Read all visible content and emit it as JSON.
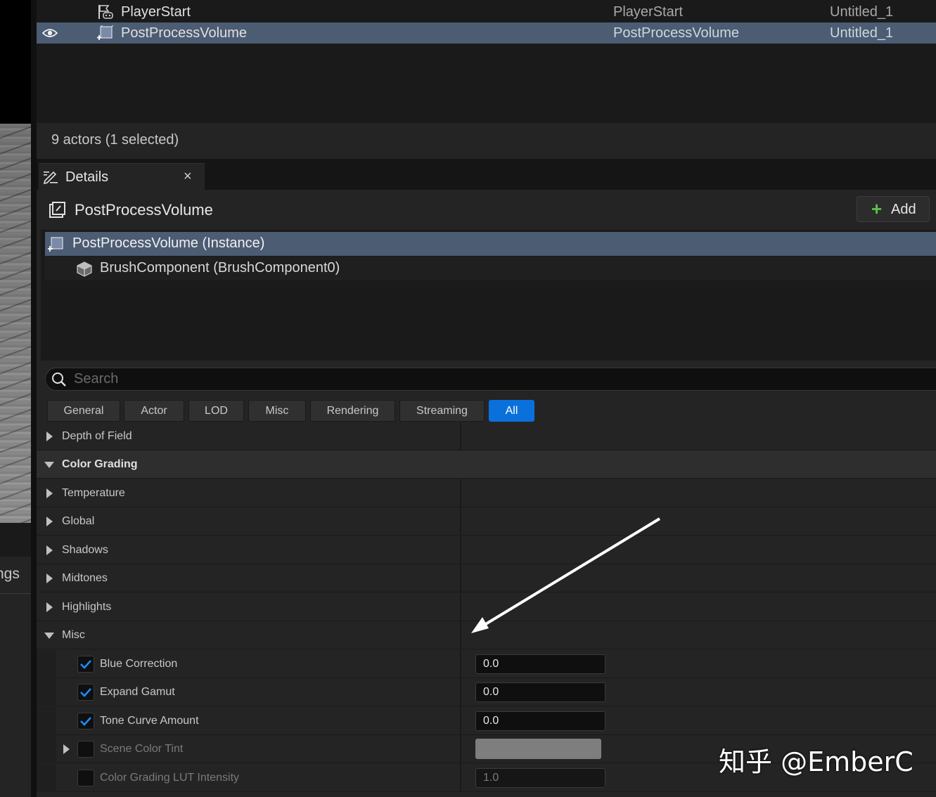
{
  "viewport": {
    "partial_label": "ngs"
  },
  "outliner": {
    "rows": [
      {
        "name": "PlayerStart",
        "type": "PlayerStart",
        "level": "Untitled_1",
        "selected": false
      },
      {
        "name": "PostProcessVolume",
        "type": "PostProcessVolume",
        "level": "Untitled_1",
        "selected": true
      }
    ],
    "status": "9 actors (1 selected)"
  },
  "details": {
    "tab_label": "Details",
    "tab_close": "×",
    "actor_name": "PostProcessVolume",
    "add_label": "Add",
    "components": {
      "root": "PostProcessVolume (Instance)",
      "child": "BrushComponent (BrushComponent0)"
    },
    "search_placeholder": "Search",
    "filters": [
      "General",
      "Actor",
      "LOD",
      "Misc",
      "Rendering",
      "Streaming",
      "All"
    ],
    "active_filter": "All",
    "categories": {
      "depth_of_field": "Depth of Field",
      "color_grading": "Color Grading",
      "temperature": "Temperature",
      "global": "Global",
      "shadows": "Shadows",
      "midtones": "Midtones",
      "highlights": "Highlights",
      "misc": "Misc"
    },
    "misc_props": [
      {
        "label": "Blue Correction",
        "checked": true,
        "value": "0.0"
      },
      {
        "label": "Expand Gamut",
        "checked": true,
        "value": "0.0"
      },
      {
        "label": "Tone Curve Amount",
        "checked": true,
        "value": "0.0"
      },
      {
        "label": "Scene Color Tint",
        "checked": false,
        "value": ""
      },
      {
        "label": "Color Grading LUT Intensity",
        "checked": false,
        "value": "1.0"
      }
    ]
  },
  "colors": {
    "selection": "#4b5c73",
    "accent_blue": "#0a70dc",
    "add_green": "#5cc04a"
  },
  "watermark": "知乎 @EmberC"
}
